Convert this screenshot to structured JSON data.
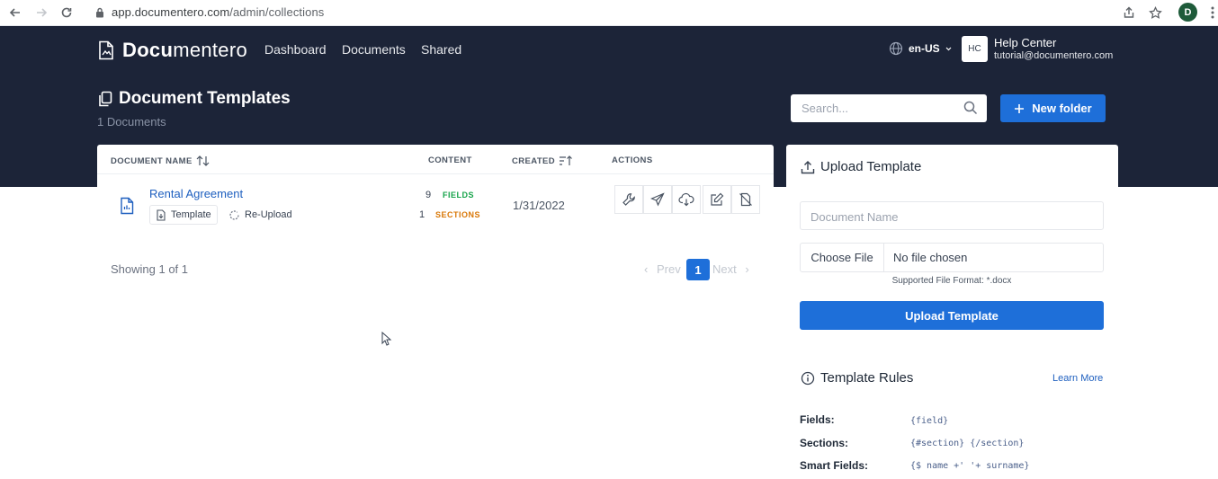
{
  "browser": {
    "url_host": "app.documentero.com",
    "url_path": "/admin/collections",
    "profile_initial": "D"
  },
  "header": {
    "logo_bold": "Docu",
    "logo_rest": "mentero",
    "nav": [
      "Dashboard",
      "Documents",
      "Shared"
    ],
    "language": "en-US",
    "avatar_initials": "HC",
    "user_name": "Help Center",
    "user_email": "tutorial@documentero.com"
  },
  "page": {
    "title": "Document Templates",
    "count": "1 Documents",
    "search_placeholder": "Search...",
    "new_folder_label": "New folder"
  },
  "table": {
    "columns": [
      "DOCUMENT NAME",
      "CONTENT",
      "CREATED",
      "ACTIONS"
    ],
    "rows": [
      {
        "name": "Rental Agreement",
        "template_label": "Template",
        "reupload_label": "Re-Upload",
        "fields_count": "9",
        "fields_label": "FIELDS",
        "sections_count": "1",
        "sections_label": "SECTIONS",
        "created": "1/31/2022"
      }
    ],
    "showing": "Showing 1 of 1",
    "prev": "Prev",
    "current_page": "1",
    "next": "Next"
  },
  "upload": {
    "title": "Upload Template",
    "doc_name_placeholder": "Document Name",
    "choose_file": "Choose File",
    "no_file": "No file chosen",
    "supported": "Supported File Format: *.docx",
    "button": "Upload Template"
  },
  "rules": {
    "title": "Template Rules",
    "learn_more": "Learn More",
    "items": [
      {
        "label": "Fields:",
        "code": "{field}"
      },
      {
        "label": "Sections:",
        "code": "{#section} {/section}"
      },
      {
        "label": "Smart Fields:",
        "code": "{$ name +' '+ surname}"
      }
    ]
  },
  "colors": {
    "header_bg": "#1c2438",
    "primary": "#1e6fd9",
    "fields_tag": "#16a34a",
    "sections_tag": "#d97706"
  }
}
